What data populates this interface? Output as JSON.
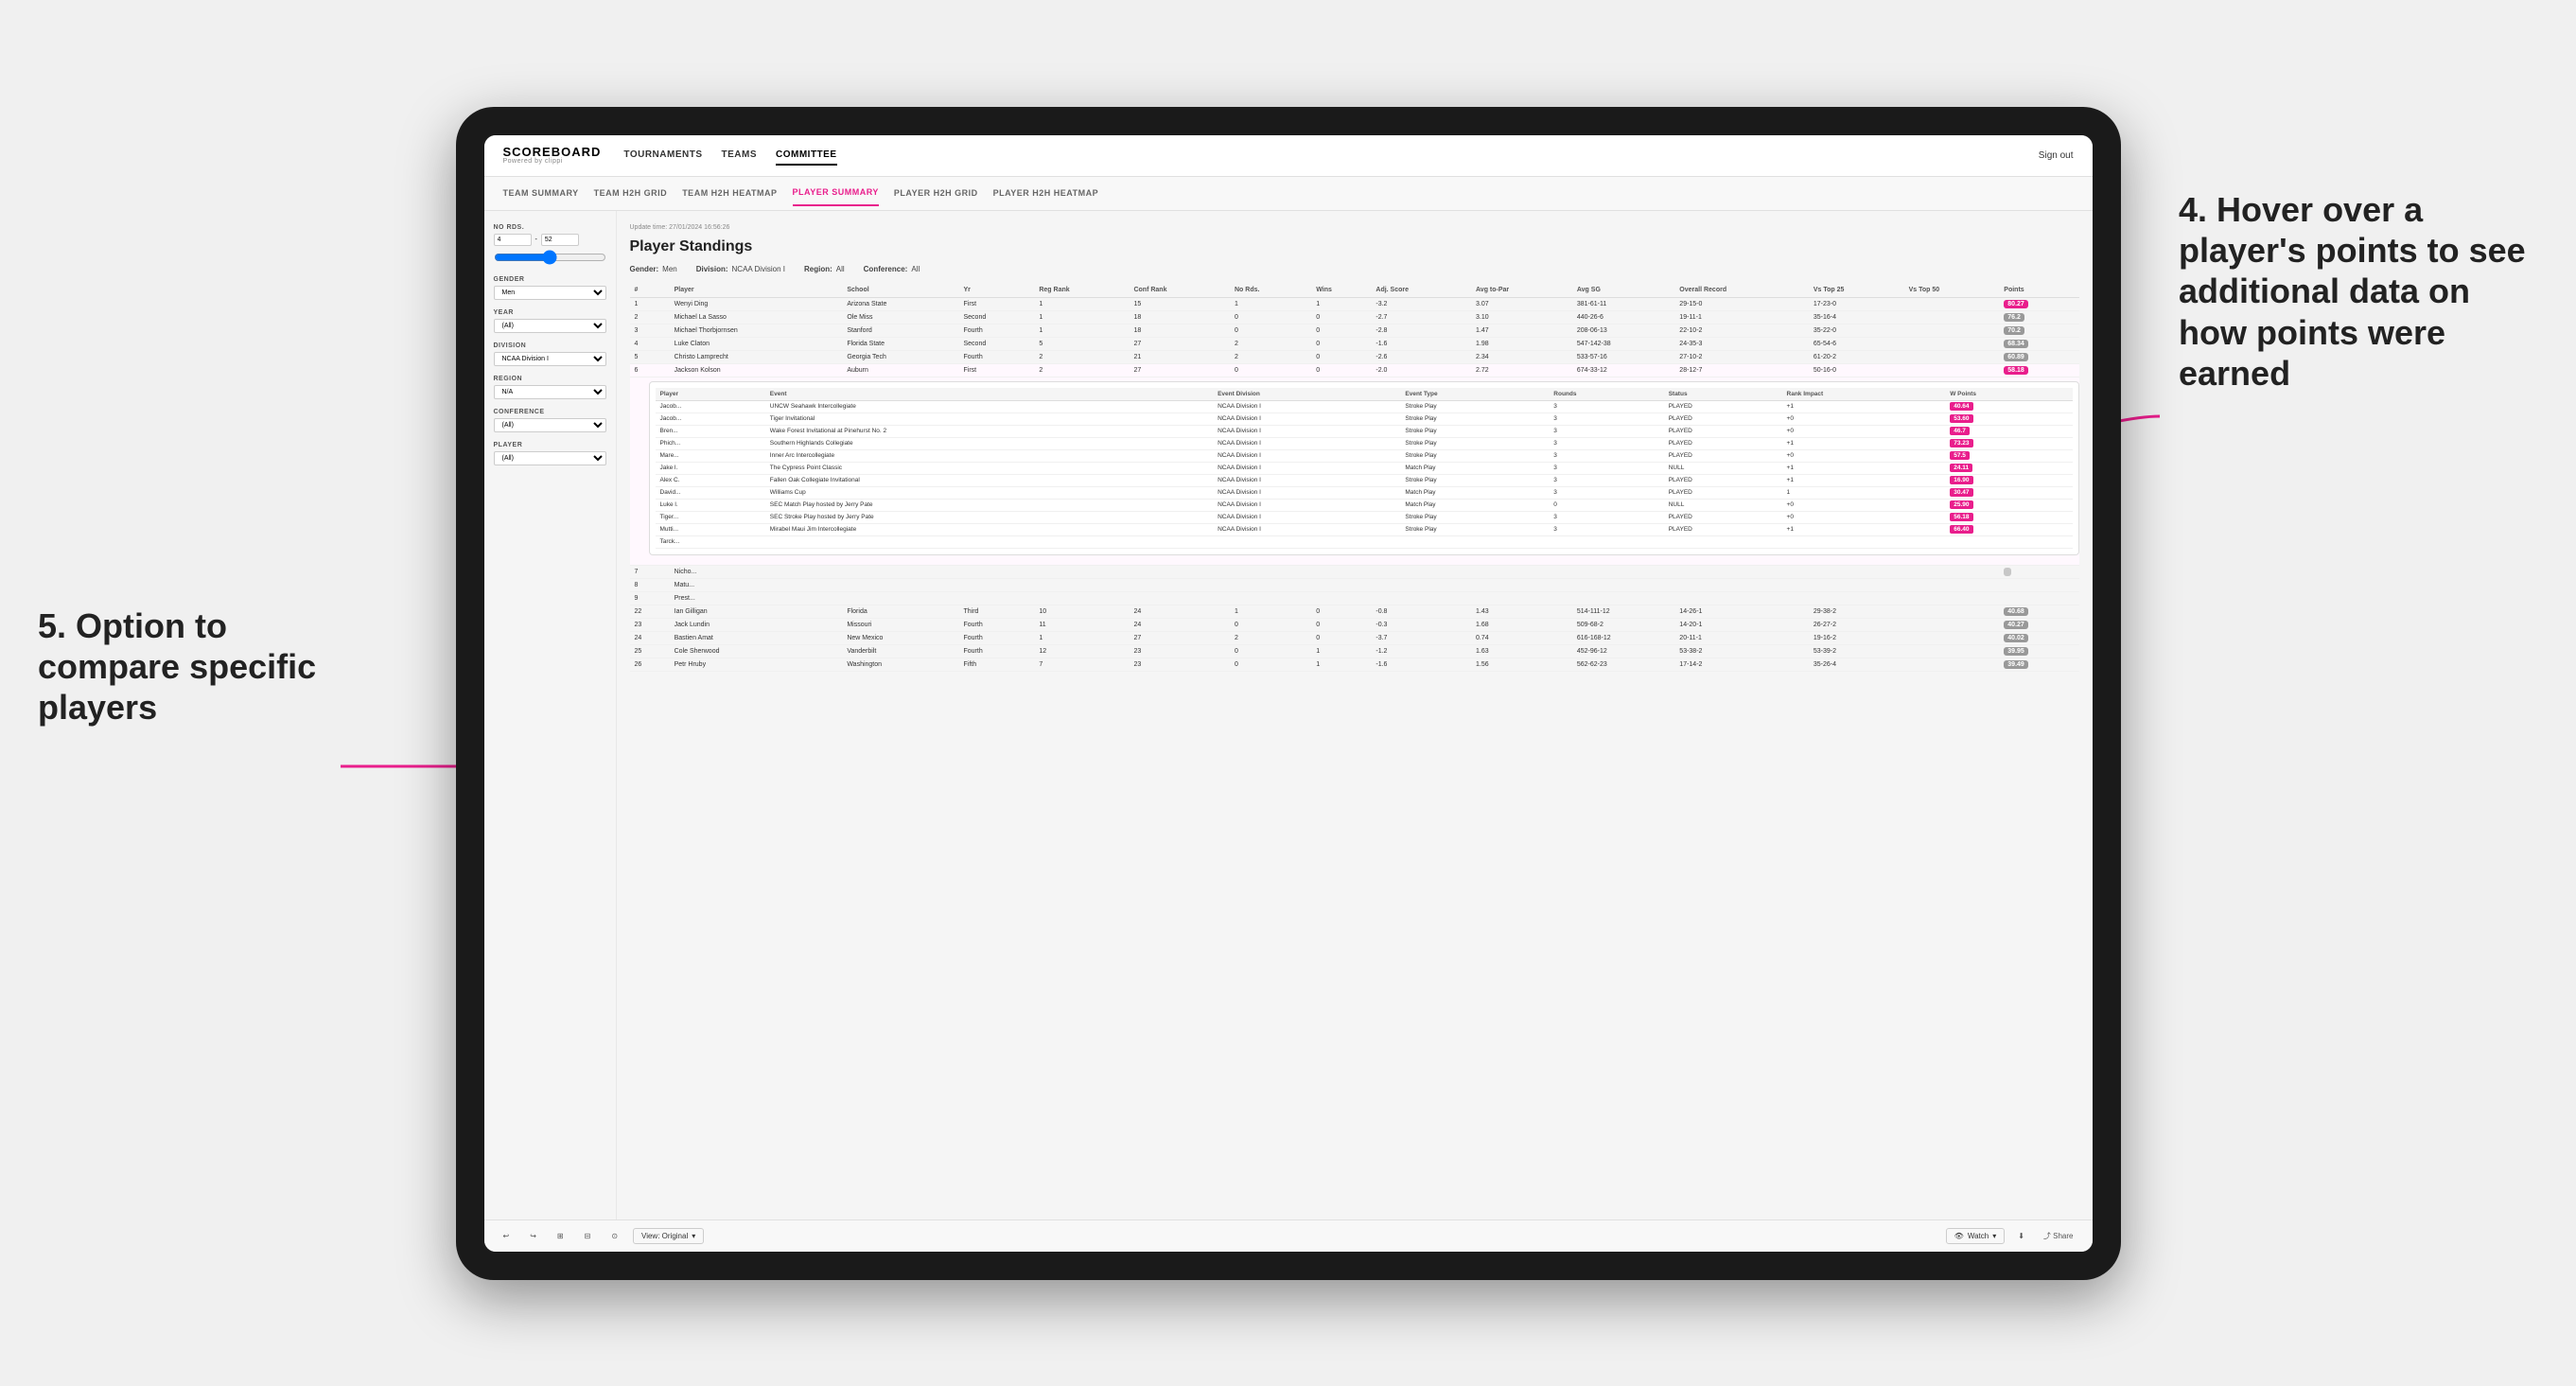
{
  "app": {
    "logo_main": "SCOREBOARD",
    "logo_sub": "Powered by clippi",
    "sign_in": "Sign out"
  },
  "nav": {
    "items": [
      "TOURNAMENTS",
      "TEAMS",
      "COMMITTEE"
    ],
    "active": "COMMITTEE"
  },
  "sub_nav": {
    "items": [
      "TEAM SUMMARY",
      "TEAM H2H GRID",
      "TEAM H2H HEATMAP",
      "PLAYER SUMMARY",
      "PLAYER H2H GRID",
      "PLAYER H2H HEATMAP"
    ],
    "active": "PLAYER SUMMARY"
  },
  "sidebar": {
    "no_rds_label": "No Rds.",
    "no_rds_from": "4",
    "no_rds_to": "52",
    "gender_label": "Gender",
    "gender_value": "Men",
    "year_label": "Year",
    "year_value": "(All)",
    "division_label": "Division",
    "division_value": "NCAA Division I",
    "region_label": "Region",
    "region_value": "N/A",
    "conference_label": "Conference",
    "conference_value": "(All)",
    "player_label": "Player",
    "player_value": "(All)"
  },
  "content": {
    "update_time": "Update time: 27/01/2024 16:56:26",
    "page_title": "Player Standings",
    "filters": {
      "gender": "Men",
      "division": "NCAA Division I",
      "region": "All",
      "conference": "All"
    },
    "table_headers": [
      "#",
      "Player",
      "School",
      "Yr",
      "Reg Rank",
      "Conf Rank",
      "No Rds.",
      "Wins",
      "Adj. Score",
      "Avg to-Par",
      "Avg SG",
      "Overall Record",
      "Vs Top 25",
      "Vs Top 50",
      "Points"
    ],
    "rows": [
      {
        "rank": 1,
        "player": "Wenyi Ding",
        "school": "Arizona State",
        "yr": "First",
        "reg_rank": 1,
        "conf_rank": 15,
        "no_rds": 1,
        "wins": 1,
        "adj_score": "-3.2",
        "avg_to_par": 3.07,
        "avg_sg": "381-61-11",
        "overall": "29-15-0",
        "vs_top25": "17-23-0",
        "vs_top50": "",
        "points": "80.27",
        "points_color": "pink"
      },
      {
        "rank": 2,
        "player": "Michael La Sasso",
        "school": "Ole Miss",
        "yr": "Second",
        "reg_rank": 1,
        "conf_rank": 18,
        "no_rds": 0,
        "wins": 0,
        "adj_score": "-2.7",
        "avg_to_par": 3.1,
        "avg_sg": "440-26-6",
        "overall": "19-11-1",
        "vs_top25": "35-16-4",
        "vs_top50": "",
        "points": "76.2",
        "points_color": "gray"
      },
      {
        "rank": 3,
        "player": "Michael Thorbjornsen",
        "school": "Stanford",
        "yr": "Fourth",
        "reg_rank": 1,
        "conf_rank": 18,
        "no_rds": 0,
        "wins": 0,
        "adj_score": "-2.8",
        "avg_to_par": 1.47,
        "avg_sg": "208-06-13",
        "overall": "22-10-2",
        "vs_top25": "35-22-0",
        "vs_top50": "",
        "points": "70.2",
        "points_color": "gray"
      },
      {
        "rank": 4,
        "player": "Luke Claton",
        "school": "Florida State",
        "yr": "Second",
        "reg_rank": 5,
        "conf_rank": 27,
        "no_rds": 2,
        "wins": 0,
        "adj_score": "-1.6",
        "avg_to_par": 1.98,
        "avg_sg": "547-142-38",
        "overall": "24-35-3",
        "vs_top25": "65-54-6",
        "vs_top50": "",
        "points": "68.34",
        "points_color": "gray"
      },
      {
        "rank": 5,
        "player": "Christo Lamprecht",
        "school": "Georgia Tech",
        "yr": "Fourth",
        "reg_rank": 2,
        "conf_rank": 21,
        "no_rds": 2,
        "wins": 0,
        "adj_score": "-2.6",
        "avg_to_par": 2.34,
        "avg_sg": "533-57-16",
        "overall": "27-10-2",
        "vs_top25": "61-20-2",
        "vs_top50": "",
        "points": "60.89",
        "points_color": "gray"
      },
      {
        "rank": 6,
        "player": "Jackson Kolson",
        "school": "Auburn",
        "yr": "First",
        "reg_rank": 2,
        "conf_rank": 27,
        "no_rds": 0,
        "wins": 0,
        "adj_score": "-2.0",
        "avg_to_par": 2.72,
        "avg_sg": "674-33-12",
        "overall": "28-12-7",
        "vs_top25": "50-16-0",
        "vs_top50": "",
        "points": "58.18",
        "points_color": "gray"
      },
      {
        "rank": 7,
        "player": "Nicho...",
        "school": "",
        "yr": "",
        "reg_rank": "",
        "conf_rank": "",
        "no_rds": "",
        "wins": "",
        "adj_score": "",
        "avg_to_par": "",
        "avg_sg": "",
        "overall": "",
        "vs_top25": "",
        "vs_top50": "",
        "points": "",
        "points_color": ""
      },
      {
        "rank": 8,
        "player": "Matu...",
        "school": "",
        "yr": "",
        "reg_rank": "",
        "conf_rank": "",
        "no_rds": "",
        "wins": "",
        "adj_score": "",
        "avg_to_par": "",
        "avg_sg": "",
        "overall": "",
        "vs_top25": "",
        "vs_top50": "",
        "points": "",
        "points_color": ""
      },
      {
        "rank": 9,
        "player": "Prest...",
        "school": "",
        "yr": "",
        "reg_rank": "",
        "conf_rank": "",
        "no_rds": "",
        "wins": "",
        "adj_score": "",
        "avg_to_par": "",
        "avg_sg": "",
        "overall": "",
        "vs_top25": "",
        "vs_top50": "",
        "points": "",
        "points_color": ""
      }
    ],
    "expanded_player": "Jackson Kolson",
    "expanded_headers": [
      "Player",
      "Event",
      "Event Division",
      "Event Type",
      "Rounds",
      "Status",
      "Rank Impact",
      "W Points"
    ],
    "expanded_rows": [
      {
        "player": "Jacob...",
        "event": "UNCW Seahawk Intercollegiate",
        "division": "NCAA Division I",
        "type": "Stroke Play",
        "rounds": 3,
        "status": "PLAYED",
        "rank_impact": "+1",
        "w_points": "40.64",
        "badge": "pink"
      },
      {
        "player": "Jacob...",
        "event": "Tiger Invitational",
        "division": "NCAA Division I",
        "type": "Stroke Play",
        "rounds": 3,
        "status": "PLAYED",
        "rank_impact": "+0",
        "w_points": "53.60",
        "badge": "pink"
      },
      {
        "player": "Bren...",
        "event": "Wake Forest Invitational at Pinehurst No. 2",
        "division": "NCAA Division I",
        "type": "Stroke Play",
        "rounds": 3,
        "status": "PLAYED",
        "rank_impact": "+0",
        "w_points": "46.7",
        "badge": "pink"
      },
      {
        "player": "Phich...",
        "event": "Southern Highlands Collegiate",
        "division": "NCAA Division I",
        "type": "Stroke Play",
        "rounds": 3,
        "status": "PLAYED",
        "rank_impact": "+1",
        "w_points": "73.23",
        "badge": "pink"
      },
      {
        "player": "Mare...",
        "event": "Inner Arc Intercollegiate",
        "division": "NCAA Division I",
        "type": "Stroke Play",
        "rounds": 3,
        "status": "PLAYED",
        "rank_impact": "+0",
        "w_points": "57.5",
        "badge": "pink"
      },
      {
        "player": "Jake l.",
        "event": "The Cypress Point Classic",
        "division": "NCAA Division I",
        "type": "Match Play",
        "rounds": 3,
        "status": "NULL",
        "rank_impact": "+1",
        "w_points": "24.11",
        "badge": "pink"
      },
      {
        "player": "Alex C.",
        "event": "Fallen Oak Collegiate Invitational",
        "division": "NCAA Division I",
        "type": "Stroke Play",
        "rounds": 3,
        "status": "PLAYED",
        "rank_impact": "+1",
        "w_points": "16.90",
        "badge": "pink"
      },
      {
        "player": "David...",
        "event": "Williams Cup",
        "division": "NCAA Division I",
        "type": "Match Play",
        "rounds": 3,
        "status": "PLAYED",
        "rank_impact": "1",
        "w_points": "30.47",
        "badge": "pink"
      },
      {
        "player": "Luke l.",
        "event": "SEC Match Play hosted by Jerry Pate",
        "division": "NCAA Division I",
        "type": "Match Play",
        "rounds": 0,
        "status": "NULL",
        "rank_impact": "+0",
        "w_points": "25.90",
        "badge": "pink"
      },
      {
        "player": "Tiger...",
        "event": "SEC Stroke Play hosted by Jerry Pate",
        "division": "NCAA Division I",
        "type": "Stroke Play",
        "rounds": 3,
        "status": "PLAYED",
        "rank_impact": "+0",
        "w_points": "56.18",
        "badge": "pink"
      },
      {
        "player": "Mutti...",
        "event": "Mirabel Maui Jim Intercollegiate",
        "division": "NCAA Division I",
        "type": "Stroke Play",
        "rounds": 3,
        "status": "PLAYED",
        "rank_impact": "+1",
        "w_points": "66.40",
        "badge": "pink"
      },
      {
        "player": "Tarck...",
        "event": "",
        "division": "",
        "type": "",
        "rounds": "",
        "status": "",
        "rank_impact": "",
        "w_points": "",
        "badge": ""
      }
    ],
    "lower_rows": [
      {
        "rank": 22,
        "player": "Ian Gilligan",
        "school": "Florida",
        "yr": "Third",
        "reg_rank": 10,
        "conf_rank": 24,
        "no_rds": 1,
        "wins": 0,
        "adj_score": "-0.8",
        "avg_to_par": 1.43,
        "avg_sg": "514-111-12",
        "overall": "14-26-1",
        "vs_top25": "29-38-2",
        "vs_top50": "",
        "points": "40.68",
        "points_color": "gray"
      },
      {
        "rank": 23,
        "player": "Jack Lundin",
        "school": "Missouri",
        "yr": "Fourth",
        "reg_rank": 11,
        "conf_rank": 24,
        "no_rds": 0,
        "wins": 0,
        "adj_score": "-0.3",
        "avg_to_par": 1.68,
        "avg_sg": "509-68-2",
        "overall": "14-20-1",
        "vs_top25": "26-27-2",
        "vs_top50": "",
        "points": "40.27",
        "points_color": "gray"
      },
      {
        "rank": 24,
        "player": "Bastien Amat",
        "school": "New Mexico",
        "yr": "Fourth",
        "reg_rank": 1,
        "conf_rank": 27,
        "no_rds": 2,
        "wins": 0,
        "adj_score": "-3.7",
        "avg_to_par": 0.74,
        "avg_sg": "616-168-12",
        "overall": "20-11-1",
        "vs_top25": "19-16-2",
        "vs_top50": "",
        "points": "40.02",
        "points_color": "gray"
      },
      {
        "rank": 25,
        "player": "Cole Sherwood",
        "school": "Vanderbilt",
        "yr": "Fourth",
        "reg_rank": 12,
        "conf_rank": 23,
        "no_rds": 0,
        "wins": 1,
        "adj_score": "-1.2",
        "avg_to_par": 1.63,
        "avg_sg": "452-96-12",
        "overall": "53-38-2",
        "vs_top25": "53-39-2",
        "vs_top50": "",
        "points": "39.95",
        "points_color": "gray"
      },
      {
        "rank": 26,
        "player": "Petr Hruby",
        "school": "Washington",
        "yr": "Fifth",
        "reg_rank": 7,
        "conf_rank": 23,
        "no_rds": 0,
        "wins": 1,
        "adj_score": "-1.6",
        "avg_to_par": 1.56,
        "avg_sg": "562-62-23",
        "overall": "17-14-2",
        "vs_top25": "35-26-4",
        "vs_top50": "",
        "points": "39.49",
        "points_color": "gray"
      }
    ]
  },
  "toolbar": {
    "view_label": "View: Original",
    "watch_label": "Watch",
    "share_label": "Share"
  },
  "annotations": {
    "right_title": "4. Hover over a player's points to see additional data on how points were earned",
    "left_title": "5. Option to compare specific players"
  }
}
